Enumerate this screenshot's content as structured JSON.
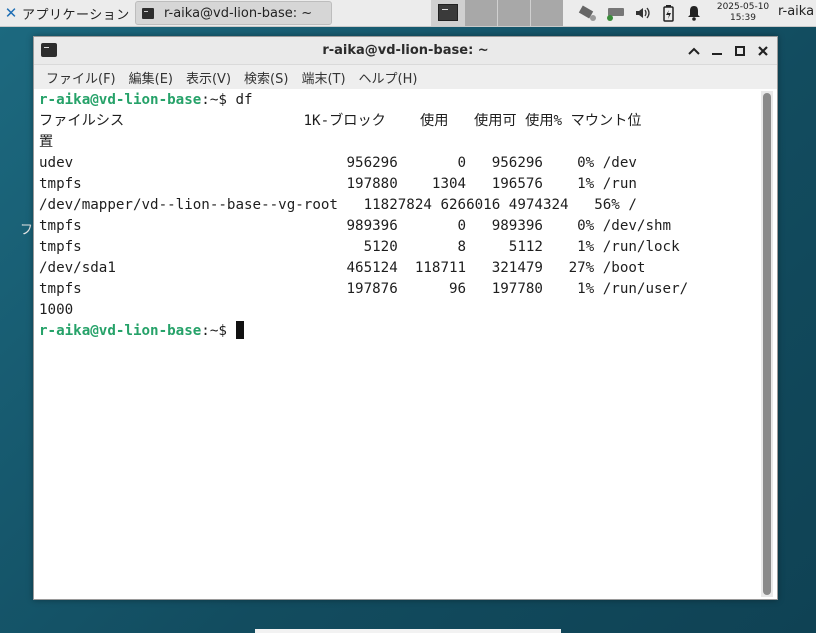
{
  "panel": {
    "apps_label": "アプリケーション",
    "task_title": "r-aika@vd-lion-base: ~",
    "clock_date": "2025-05-10",
    "clock_time": "15:39",
    "user": "r-aika"
  },
  "window": {
    "title": "r-aika@vd-lion-base: ~",
    "menu": [
      "ファイル(F)",
      "編集(E)",
      "表示(V)",
      "検索(S)",
      "端末(T)",
      "ヘルプ(H)"
    ]
  },
  "terminal": {
    "prompt_user": "r-aika@vd-lion-base",
    "prompt_path": ":~$ ",
    "command": "df",
    "lines": [
      "ファイルシス                     1K-ブロック    使用   使用可 使用% マウント位",
      "置",
      "udev                                956296       0   956296    0% /dev",
      "tmpfs                               197880    1304   196576    1% /run",
      "/dev/mapper/vd--lion--base--vg-root   11827824 6266016 4974324   56% /",
      "tmpfs                               989396       0   989396    0% /dev/shm",
      "tmpfs                                 5120       8     5112    1% /run/lock",
      "/dev/sda1                           465124  118711   321479   27% /boot",
      "tmpfs                               197876      96   197780    1% /run/user/",
      "1000"
    ]
  },
  "desktop": {
    "glyph": "フ"
  }
}
